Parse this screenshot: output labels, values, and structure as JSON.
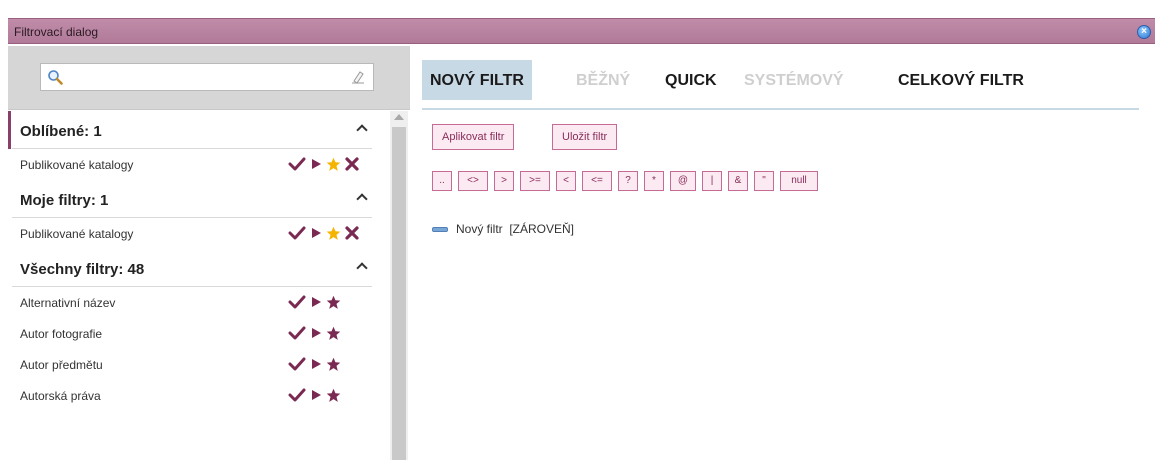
{
  "dialog": {
    "title": "Filtrovací dialog"
  },
  "search": {
    "value": "",
    "placeholder": ""
  },
  "sections": [
    {
      "label": "Oblíbené: 1",
      "rows": [
        "Publikované katalogy"
      ]
    },
    {
      "label": "Moje filtry: 1",
      "rows": [
        "Publikované katalogy"
      ]
    },
    {
      "label": "Všechny filtry: 48",
      "rows": [
        "Alternativní název",
        "Autor fotografie",
        "Autor předmětu",
        "Autorská práva"
      ]
    }
  ],
  "tabs": [
    {
      "label": "NOVÝ FILTR",
      "state": "active"
    },
    {
      "label": "BĚŽNÝ",
      "state": "disabled"
    },
    {
      "label": "QUICK",
      "state": "normal"
    },
    {
      "label": "SYSTÉMOVÝ",
      "state": "disabled"
    },
    {
      "label": "CELKOVÝ FILTR",
      "state": "normal"
    }
  ],
  "actions": {
    "apply": "Aplikovat filtr",
    "save": "Uložit filtr"
  },
  "operators": [
    "..",
    "<>",
    ">",
    ">=",
    "<",
    "<=",
    "?",
    "*",
    "@",
    "|",
    "&",
    "\"",
    "null"
  ],
  "tree": {
    "node": "Nový filtr",
    "operator": "[ZÁROVEŇ]"
  },
  "colors": {
    "titlebar": "#b07a98",
    "accent": "#8a2d5a",
    "check": "#7a2a52",
    "favorite_star": "#f5b400",
    "active_tab": "#c8d9e6"
  },
  "icons": {
    "row_actions": [
      "check-icon",
      "play-icon",
      "star-icon",
      "delete-icon"
    ]
  }
}
